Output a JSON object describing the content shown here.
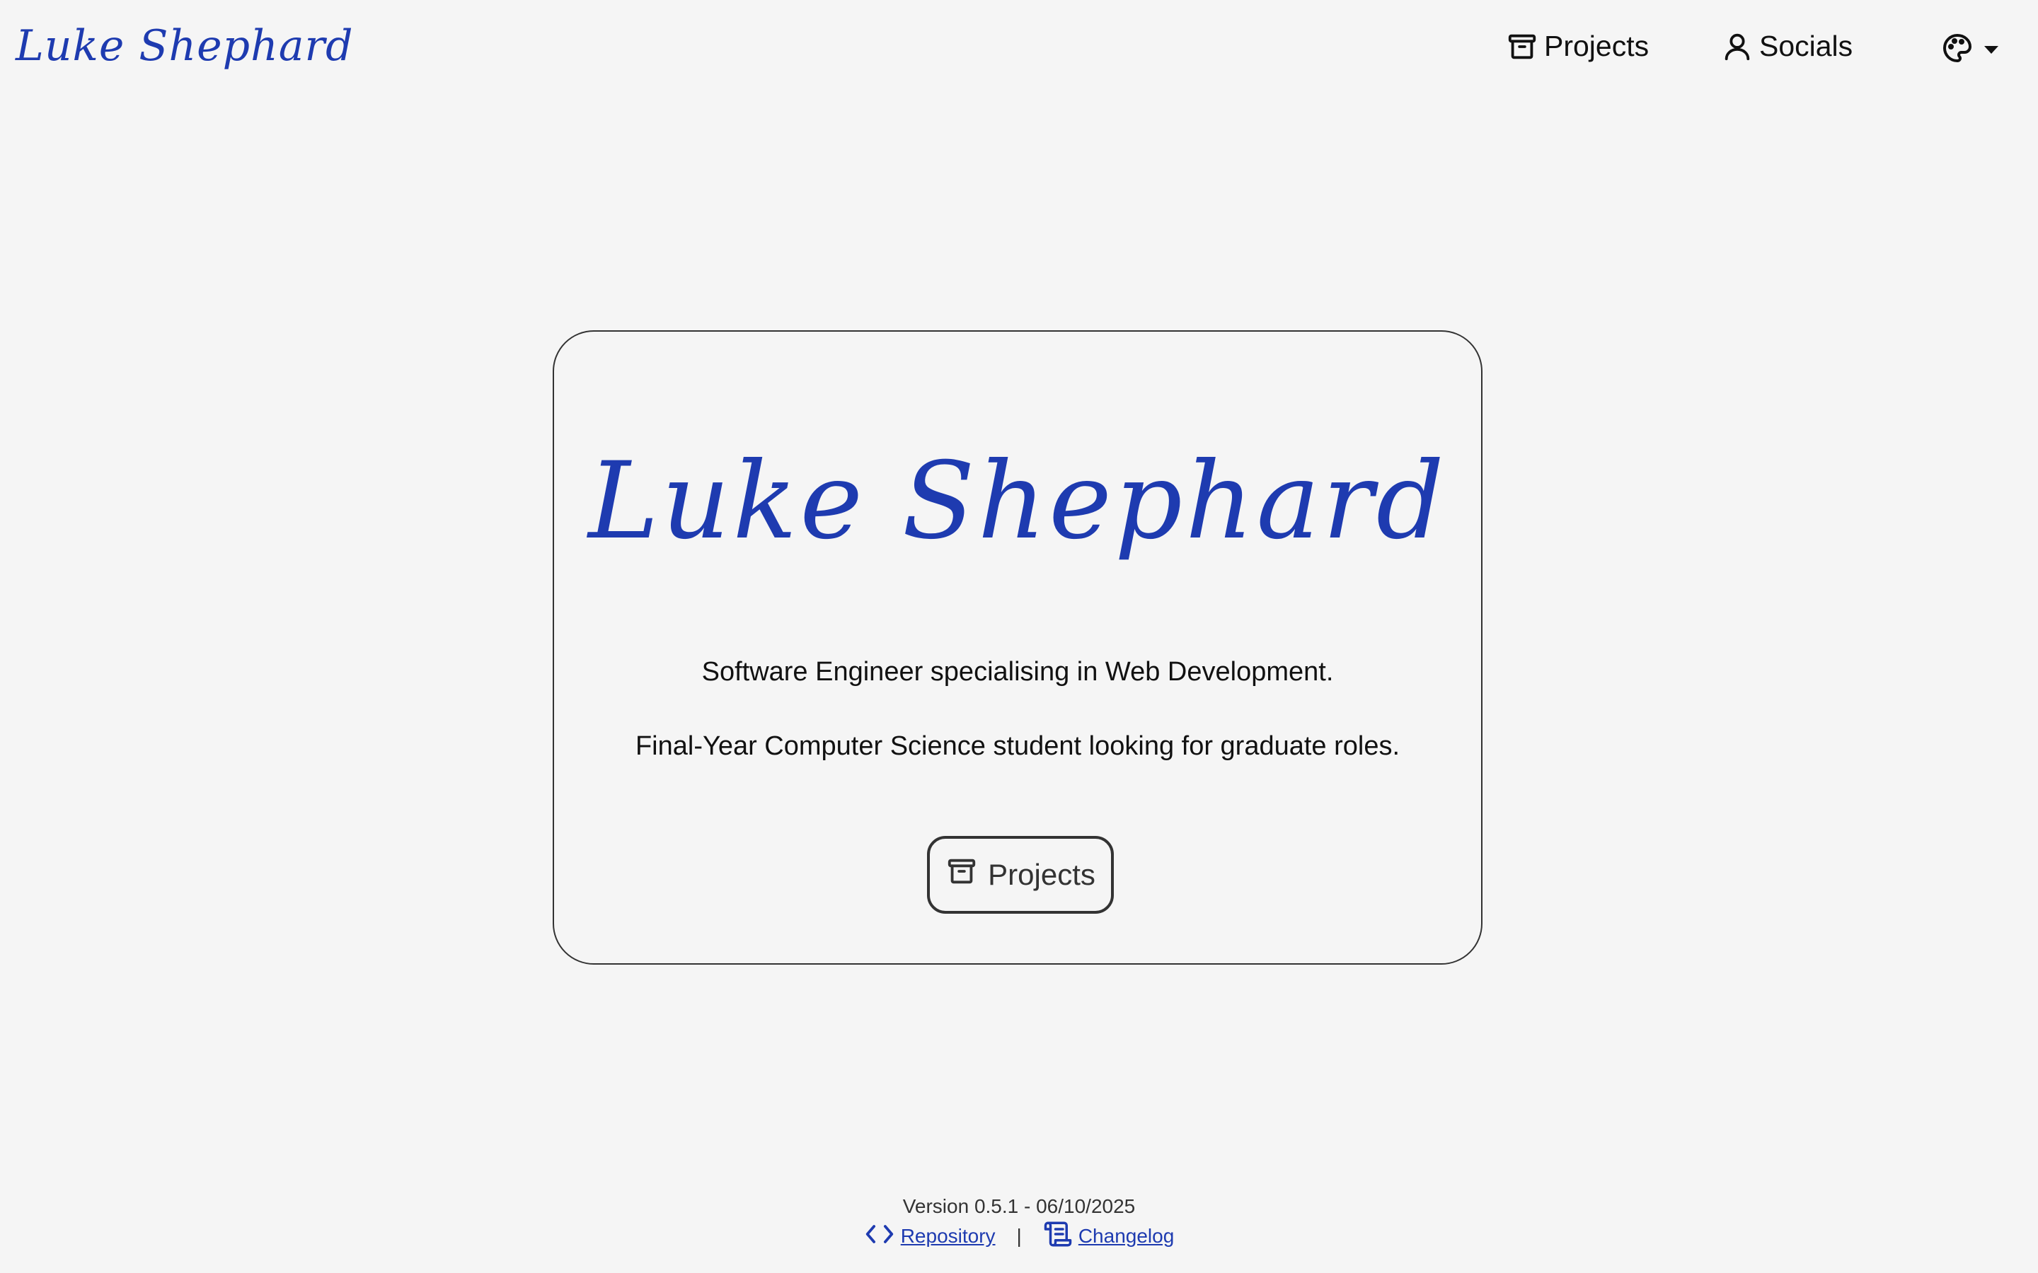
{
  "header": {
    "brand": "Luke Shephard",
    "nav": {
      "projects_label": "Projects",
      "socials_label": "Socials"
    },
    "theme_icon": "palette-icon"
  },
  "hero": {
    "title": "Luke Shephard",
    "tagline_1": "Software Engineer specialising in Web Development.",
    "tagline_2": "Final-Year Computer Science student looking for graduate roles.",
    "button_label": "Projects"
  },
  "footer": {
    "version": "Version 0.5.1 - 06/10/2025",
    "repository_label": "Repository",
    "separator": "|",
    "changelog_label": "Changelog"
  },
  "colors": {
    "accent": "#1e3bb0",
    "background": "#f5f5f5",
    "text": "#111111"
  }
}
